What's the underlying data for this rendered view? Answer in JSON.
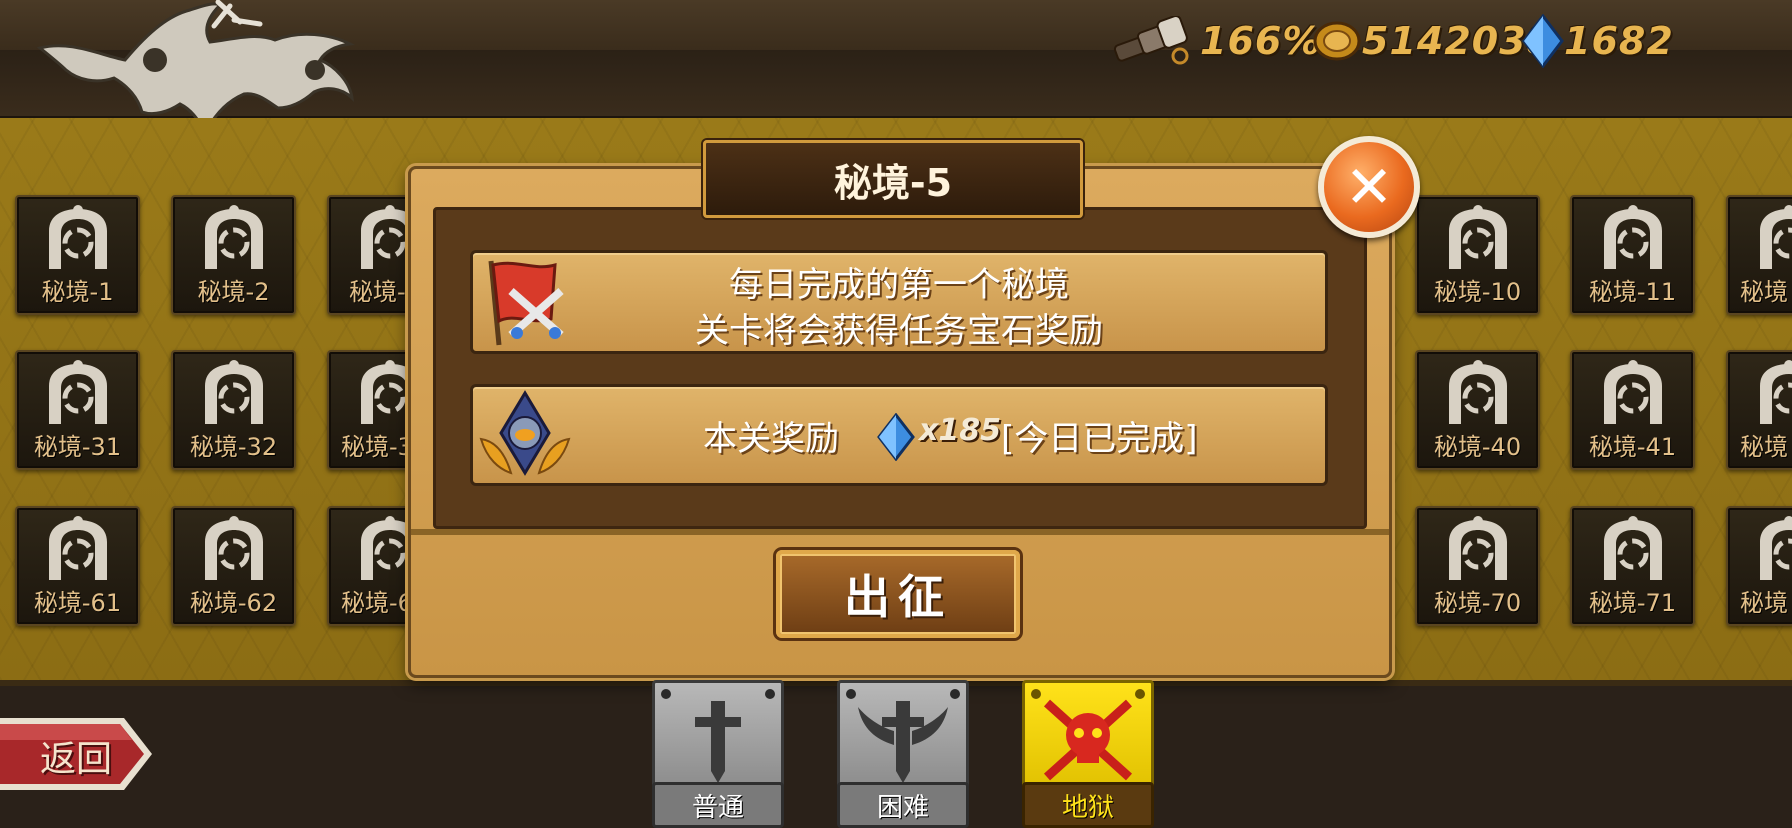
{
  "resources": {
    "spyglass_value": "166%",
    "gold_value": "5142038",
    "gems_value": "1682"
  },
  "levels": [
    {
      "label": "秘境-1"
    },
    {
      "label": "秘境-2"
    },
    {
      "label": "秘境-"
    },
    {
      "label": "秘境-10"
    },
    {
      "label": "秘境-11"
    },
    {
      "label": "秘境"
    },
    {
      "label": "秘境-31"
    },
    {
      "label": "秘境-32"
    },
    {
      "label": "秘境-3"
    },
    {
      "label": "秘境-40"
    },
    {
      "label": "秘境-41"
    },
    {
      "label": "秘境"
    },
    {
      "label": "秘境-61"
    },
    {
      "label": "秘境-62"
    },
    {
      "label": "秘境-6"
    },
    {
      "label": "秘境-70"
    },
    {
      "label": "秘境-71"
    },
    {
      "label": "秘境"
    }
  ],
  "dialog": {
    "title": "秘境-5",
    "info_line1": "每日完成的第一个秘境",
    "info_line2": "关卡将会获得任务宝石奖励",
    "reward_label": "本关奖励",
    "reward_amount": "x185",
    "reward_status": "[今日已完成]",
    "go_button": "出征",
    "close_icon": "close-icon"
  },
  "nav": {
    "back_label": "返回"
  },
  "difficulty_tabs": [
    {
      "label": "普通",
      "selected": false
    },
    {
      "label": "困难",
      "selected": false
    },
    {
      "label": "地狱",
      "selected": true
    }
  ],
  "colors": {
    "gold_text": "#e8b550",
    "board_bg": "#9a7a19",
    "dialog_bg": "#dcaa5e",
    "close_orange": "#ea6a1f",
    "selected_tab": "#f2d400",
    "back_red": "#a8282a"
  }
}
